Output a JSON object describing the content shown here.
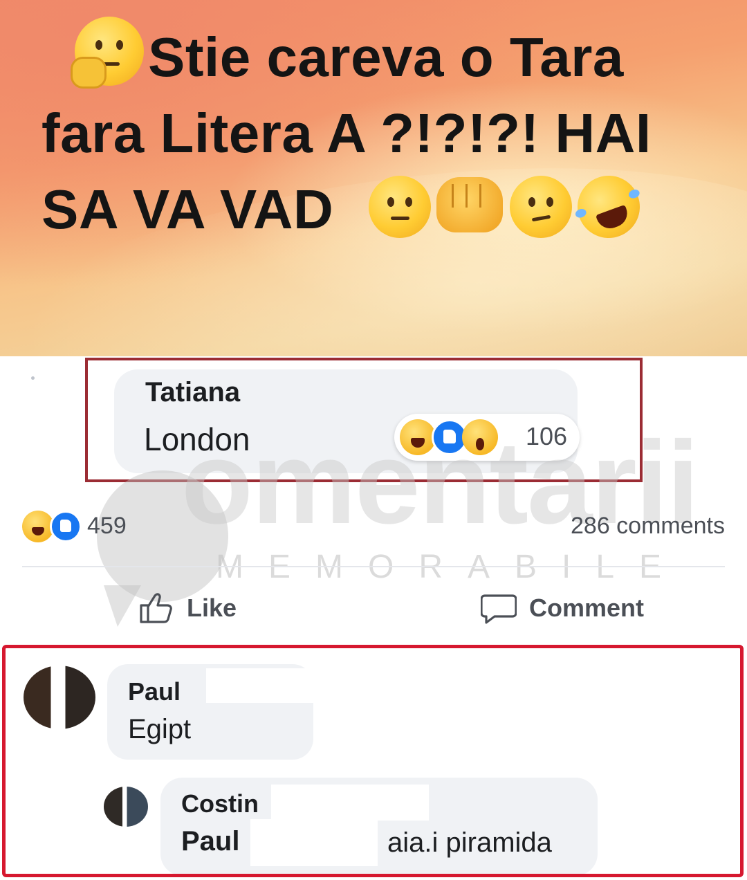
{
  "post": {
    "line1": "Stie careva o Tara",
    "line2": "fara Litera  A ?!?!?! HAI",
    "line3": "SA VA VAD",
    "emoji_thinking": "thinking-face-icon",
    "emoji_trail": [
      "raised-eyebrow-face-icon",
      "oncoming-fist-icon",
      "smirking-face-icon",
      "rolling-on-floor-laughing-icon"
    ]
  },
  "top_comment": {
    "author": "Tatiana",
    "text": "London",
    "reactions": [
      "haha",
      "like",
      "wow"
    ],
    "reaction_count": "106"
  },
  "watermark": {
    "word": "omentarii",
    "sub": "MEMORABILE"
  },
  "summary": {
    "reactions": [
      "haha",
      "like"
    ],
    "reaction_count": "459",
    "comments_label": "286 comments"
  },
  "actions": {
    "like_label": "Like",
    "comment_label": "Comment"
  },
  "comments": {
    "paul": {
      "author": "Paul",
      "text": "Egipt"
    },
    "costin": {
      "author": "Costin",
      "mention": "Paul",
      "text": "aia.i piramida"
    }
  },
  "colors": {
    "highlight_frame": "#9b2c34",
    "comments_frame": "#d6182f",
    "like_blue": "#1877f2",
    "bubble_bg": "#f0f2f5"
  }
}
